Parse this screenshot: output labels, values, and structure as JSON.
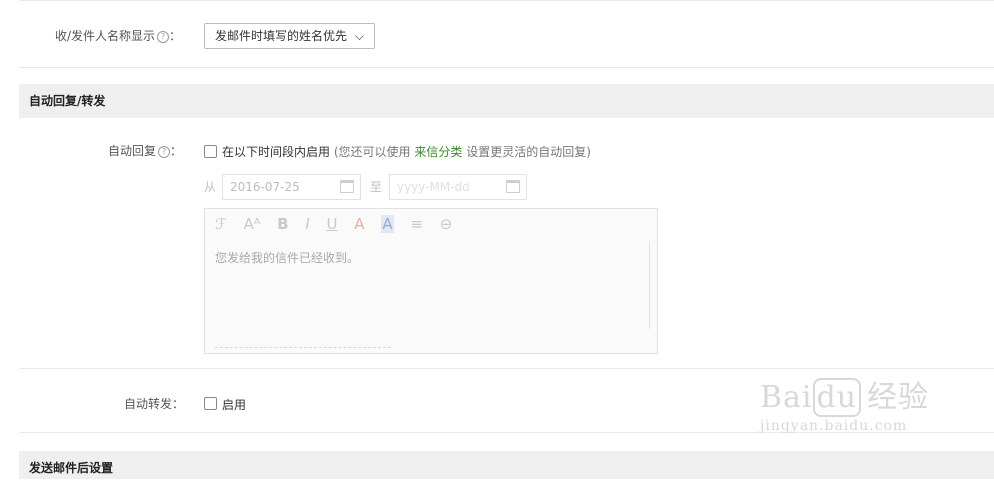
{
  "display_name": {
    "label": "收/发件人名称显示",
    "select_value": "发邮件时填写的姓名优先"
  },
  "section_auto_reply": {
    "header": "自动回复/转发",
    "auto_reply_label": "自动回复",
    "checkbox_label": "在以下时间段内启用",
    "hint_prefix": "(您还可以使用",
    "hint_link": "来信分类",
    "hint_suffix": "设置更灵活的自动回复)",
    "from_label": "从",
    "from_date": "2016-07-25",
    "to_label": "至",
    "to_placeholder": "yyyy-MM-dd",
    "editor_text": "您发给我的信件已经收到。",
    "auto_forward_label": "自动转发",
    "forward_checkbox_label": "启用"
  },
  "section_after_send": {
    "header": "发送邮件后设置"
  },
  "watermark": {
    "brand": "Bai",
    "brand_suffix": "du",
    "product": "经验",
    "url": "jingyan.baidu.com"
  },
  "icons": {
    "help": "question-circle-icon",
    "calendar": "calendar-icon",
    "editor_tools": [
      "font-icon",
      "font-size-icon",
      "bold-icon",
      "italic-icon",
      "underline-icon",
      "font-color-icon",
      "bg-color-icon",
      "align-icon",
      "link-icon"
    ]
  }
}
